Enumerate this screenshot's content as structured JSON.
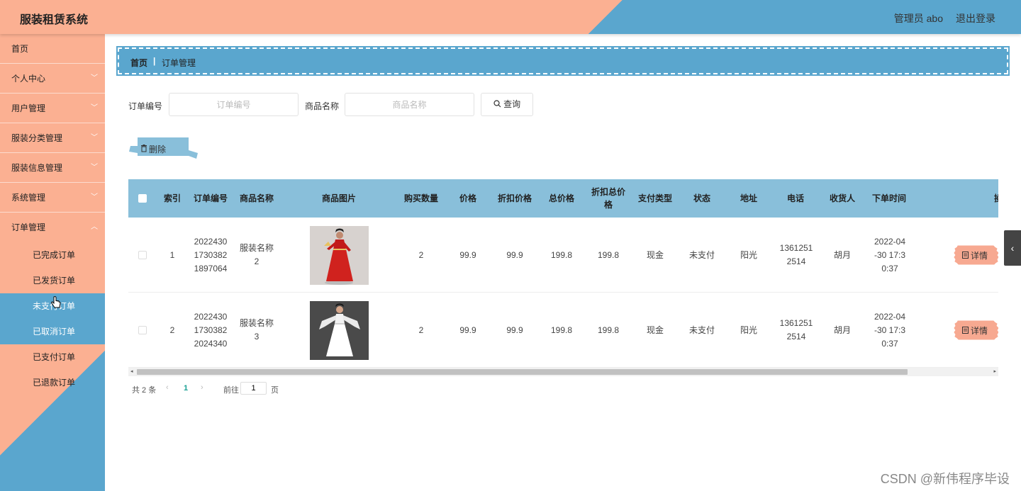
{
  "header": {
    "brand": "服装租赁系统",
    "user": "管理员 abo",
    "logout": "退出登录"
  },
  "sidebar": {
    "items": [
      {
        "label": "首页"
      },
      {
        "label": "个人中心",
        "chevron": "﹀"
      },
      {
        "label": "用户管理",
        "chevron": "﹀"
      },
      {
        "label": "服装分类管理",
        "chevron": "﹀"
      },
      {
        "label": "服装信息管理",
        "chevron": "﹀"
      },
      {
        "label": "系统管理",
        "chevron": "﹀"
      },
      {
        "label": "订单管理",
        "chevron": "︿"
      }
    ],
    "sub_items": [
      "已完成订单",
      "已发货订单",
      "未支付订单",
      "已取消订单",
      "已支付订单",
      "已退款订单"
    ]
  },
  "breadcrumb": {
    "home": "首页",
    "sep": "|",
    "current": "订单管理"
  },
  "search": {
    "order_label": "订单编号",
    "order_placeholder": "订单编号",
    "product_label": "商品名称",
    "product_placeholder": "商品名称",
    "button": "查询"
  },
  "actions": {
    "delete": "删除"
  },
  "table": {
    "headers": [
      "索引",
      "订单编号",
      "商品名称",
      "商品图片",
      "购买数量",
      "价格",
      "折扣价格",
      "总价格",
      "折扣总价格",
      "支付类型",
      "状态",
      "地址",
      "电话",
      "收货人",
      "下单时间",
      "操"
    ],
    "rows": [
      {
        "index": "1",
        "order_no": "20224301730382 1897064",
        "product": "服装名称2",
        "qty": "2",
        "price": "99.9",
        "discount_price": "99.9",
        "total": "199.8",
        "discount_total": "199.8",
        "pay_type": "现金",
        "status": "未支付",
        "address": "阳光",
        "phone": "13612512514",
        "receiver": "胡月",
        "time": "2022-04-30 17:30:37",
        "detail": "详情"
      },
      {
        "index": "2",
        "order_no": "20224301730382 2024340",
        "product": "服装名称3",
        "qty": "2",
        "price": "99.9",
        "discount_price": "99.9",
        "total": "199.8",
        "discount_total": "199.8",
        "pay_type": "现金",
        "status": "未支付",
        "address": "阳光",
        "phone": "13612512514",
        "receiver": "胡月",
        "time": "2022-04-30 17:30:37",
        "detail": "详情"
      }
    ]
  },
  "pagination": {
    "total": "共 2 条",
    "prev": "‹",
    "page": "1",
    "next": "›",
    "goto": "前往",
    "goto_value": "1",
    "page_suffix": "页"
  },
  "scroll": {
    "left": "◂",
    "right": "▸"
  },
  "side_tab": "‹",
  "watermark": "CSDN @新伟程序毕设",
  "icons": {
    "search": "search-icon",
    "trash": "trash-icon",
    "detail": "document-icon"
  },
  "colors": {
    "peach": "#fbb092",
    "blue": "#5aa6ce",
    "table_header": "#89bfda"
  }
}
